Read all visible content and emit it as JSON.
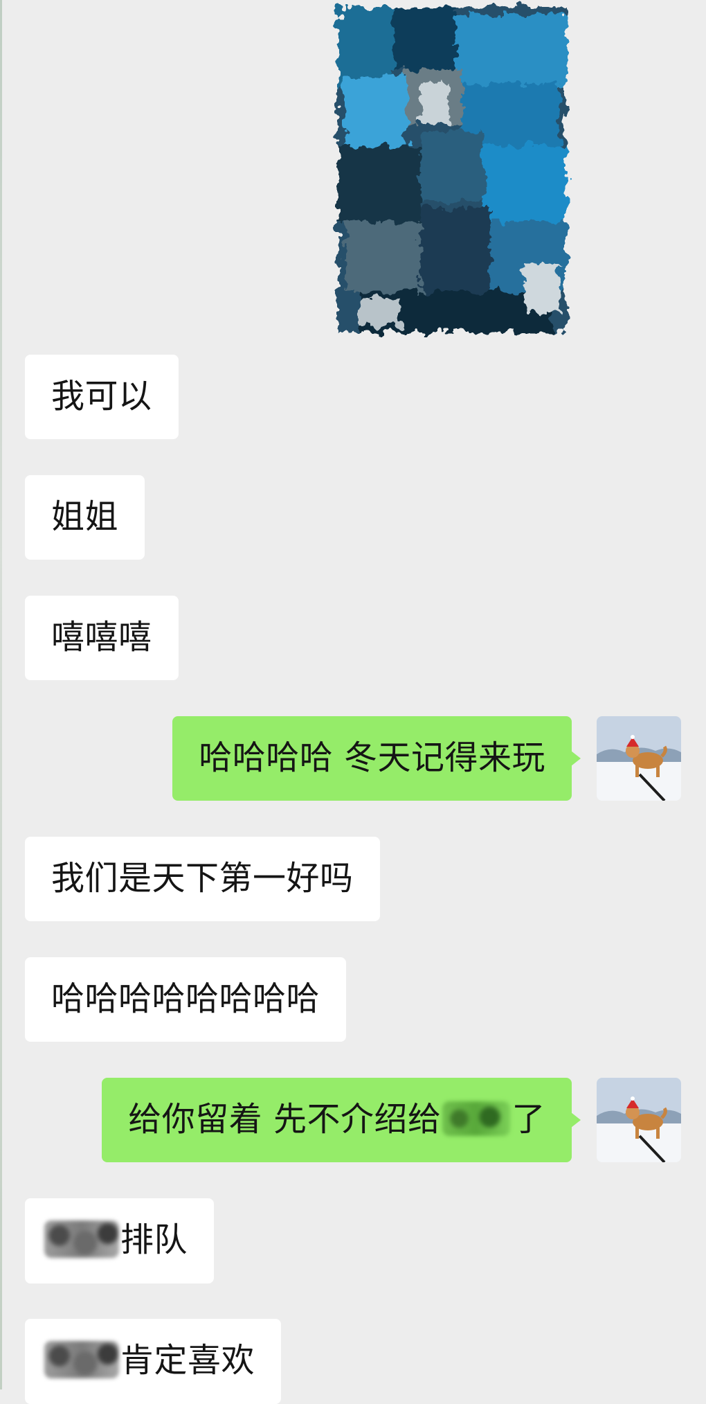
{
  "chat": {
    "messages": [
      {
        "id": "m1",
        "side": "left",
        "text": "我可以"
      },
      {
        "id": "m2",
        "side": "left",
        "text": "姐姐"
      },
      {
        "id": "m3",
        "side": "left",
        "text": "嘻嘻嘻"
      },
      {
        "id": "m4",
        "side": "right",
        "text": "哈哈哈哈 冬天记得来玩"
      },
      {
        "id": "m5",
        "side": "left",
        "text": "我们是天下第一好吗"
      },
      {
        "id": "m6",
        "side": "left",
        "text": "哈哈哈哈哈哈哈哈"
      },
      {
        "id": "m7",
        "side": "right",
        "text_before": "给你留着 先不介绍给",
        "text_after": "了"
      },
      {
        "id": "m8",
        "side": "left",
        "text": "排队"
      },
      {
        "id": "m9",
        "side": "left",
        "text": "肯定喜欢"
      }
    ],
    "avatar_icon": "shiba-dog-snow-avatar",
    "image_message_icon": "pixelated-image",
    "colors": {
      "background": "#ededed",
      "incoming_bubble": "#ffffff",
      "outgoing_bubble": "#95ec69",
      "text": "#151515"
    }
  }
}
